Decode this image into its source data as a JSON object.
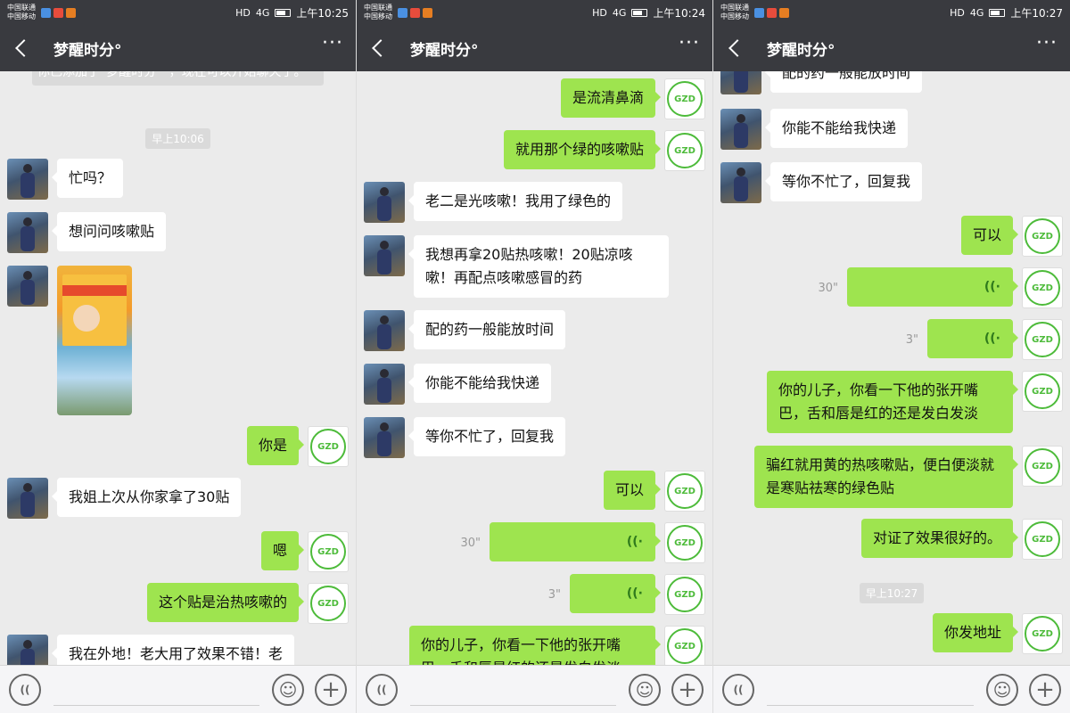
{
  "status": {
    "carrier1": "中国联通",
    "carrier2": "中国移动",
    "signal": "4G",
    "network_label": "HD"
  },
  "icons": {
    "back": "chevron-left-icon",
    "more": "more-dots-icon",
    "voice_toggle": "voice-toggle-icon",
    "emoji": "emoji-icon",
    "plus": "plus-icon",
    "voice_wave": "voice-wave-icon"
  },
  "colors": {
    "navbar": "#393a3f",
    "sent_bubble": "#9ee44f",
    "received_bubble": "#ffffff",
    "chat_bg": "#ebebeb"
  },
  "screens": [
    {
      "time": "上午10:25",
      "title": "梦醒时分°",
      "system_text": "你已添加了“梦醒时分°”，现在可以开始聊天了。",
      "timestamp": "早上10:06",
      "messages": [
        {
          "side": "left",
          "text": "忙吗？"
        },
        {
          "side": "left",
          "text": "想问问咳嗽贴"
        },
        {
          "side": "right",
          "text": "你是"
        },
        {
          "side": "left",
          "text": "我姐上次从你家拿了30贴"
        },
        {
          "side": "right",
          "text": "嗯"
        },
        {
          "side": "right",
          "text": "这个贴是治热咳嗽的"
        },
        {
          "side": "left",
          "text": "我在外地！老大用了效果不错！老"
        }
      ]
    },
    {
      "time": "上午10:24",
      "title": "梦醒时分°",
      "messages": [
        {
          "side": "right",
          "text": "是流清鼻滴"
        },
        {
          "side": "right",
          "text": "就用那个绿的咳嗽贴"
        },
        {
          "side": "left",
          "text": "老二是光咳嗽！我用了绿色的"
        },
        {
          "side": "left",
          "text": "我想再拿20贴热咳嗽！20贴凉咳嗽！再配点咳嗽感冒的药"
        },
        {
          "side": "left",
          "text": "配的药一般能放时间"
        },
        {
          "side": "left",
          "text": "你能不能给我快递"
        },
        {
          "side": "left",
          "text": "等你不忙了，回复我"
        },
        {
          "side": "right",
          "text": "可以"
        },
        {
          "side": "right",
          "text": "你的儿子，你看一下他的张开嘴巴，舌和唇是红的还是发白发淡"
        }
      ],
      "voice": [
        {
          "duration": "30\""
        },
        {
          "duration": "3\""
        }
      ]
    },
    {
      "time": "上午10:27",
      "title": "梦醒时分°",
      "timestamp": "早上10:27",
      "messages": [
        {
          "side": "left",
          "text": "配的药一般能放时间"
        },
        {
          "side": "left",
          "text": "你能不能给我快递"
        },
        {
          "side": "left",
          "text": "等你不忙了，回复我"
        },
        {
          "side": "right",
          "text": "可以"
        },
        {
          "side": "right",
          "text": "你的儿子，你看一下他的张开嘴巴，舌和唇是红的还是发白发淡"
        },
        {
          "side": "right",
          "text": "骗红就用黄的热咳嗽贴，便白便淡就是寒贴祛寒的绿色贴"
        },
        {
          "side": "right",
          "text": "对证了效果很好的。"
        },
        {
          "side": "right",
          "text": "你发地址"
        }
      ],
      "voice": [
        {
          "duration": "30\""
        },
        {
          "duration": "3\""
        }
      ]
    }
  ]
}
